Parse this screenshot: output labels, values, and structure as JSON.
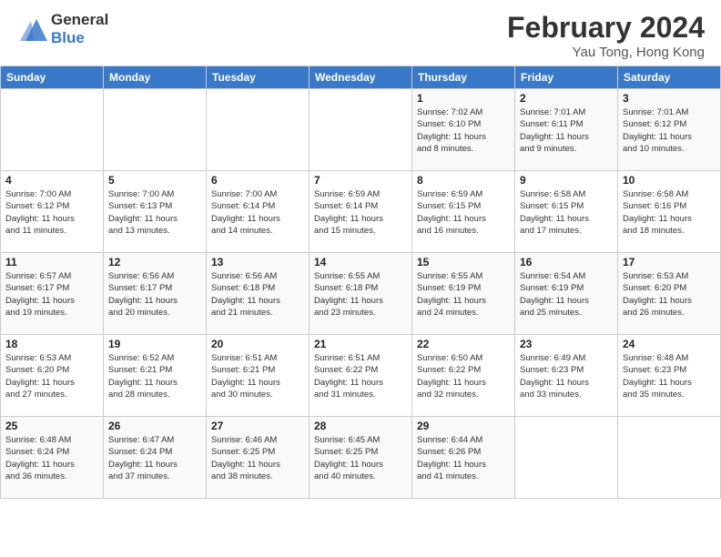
{
  "header": {
    "logo_line1": "General",
    "logo_line2": "Blue",
    "month": "February 2024",
    "location": "Yau Tong, Hong Kong"
  },
  "days_of_week": [
    "Sunday",
    "Monday",
    "Tuesday",
    "Wednesday",
    "Thursday",
    "Friday",
    "Saturday"
  ],
  "weeks": [
    [
      {
        "day": "",
        "info": ""
      },
      {
        "day": "",
        "info": ""
      },
      {
        "day": "",
        "info": ""
      },
      {
        "day": "",
        "info": ""
      },
      {
        "day": "1",
        "info": "Sunrise: 7:02 AM\nSunset: 6:10 PM\nDaylight: 11 hours\nand 8 minutes."
      },
      {
        "day": "2",
        "info": "Sunrise: 7:01 AM\nSunset: 6:11 PM\nDaylight: 11 hours\nand 9 minutes."
      },
      {
        "day": "3",
        "info": "Sunrise: 7:01 AM\nSunset: 6:12 PM\nDaylight: 11 hours\nand 10 minutes."
      }
    ],
    [
      {
        "day": "4",
        "info": "Sunrise: 7:00 AM\nSunset: 6:12 PM\nDaylight: 11 hours\nand 11 minutes."
      },
      {
        "day": "5",
        "info": "Sunrise: 7:00 AM\nSunset: 6:13 PM\nDaylight: 11 hours\nand 13 minutes."
      },
      {
        "day": "6",
        "info": "Sunrise: 7:00 AM\nSunset: 6:14 PM\nDaylight: 11 hours\nand 14 minutes."
      },
      {
        "day": "7",
        "info": "Sunrise: 6:59 AM\nSunset: 6:14 PM\nDaylight: 11 hours\nand 15 minutes."
      },
      {
        "day": "8",
        "info": "Sunrise: 6:59 AM\nSunset: 6:15 PM\nDaylight: 11 hours\nand 16 minutes."
      },
      {
        "day": "9",
        "info": "Sunrise: 6:58 AM\nSunset: 6:15 PM\nDaylight: 11 hours\nand 17 minutes."
      },
      {
        "day": "10",
        "info": "Sunrise: 6:58 AM\nSunset: 6:16 PM\nDaylight: 11 hours\nand 18 minutes."
      }
    ],
    [
      {
        "day": "11",
        "info": "Sunrise: 6:57 AM\nSunset: 6:17 PM\nDaylight: 11 hours\nand 19 minutes."
      },
      {
        "day": "12",
        "info": "Sunrise: 6:56 AM\nSunset: 6:17 PM\nDaylight: 11 hours\nand 20 minutes."
      },
      {
        "day": "13",
        "info": "Sunrise: 6:56 AM\nSunset: 6:18 PM\nDaylight: 11 hours\nand 21 minutes."
      },
      {
        "day": "14",
        "info": "Sunrise: 6:55 AM\nSunset: 6:18 PM\nDaylight: 11 hours\nand 23 minutes."
      },
      {
        "day": "15",
        "info": "Sunrise: 6:55 AM\nSunset: 6:19 PM\nDaylight: 11 hours\nand 24 minutes."
      },
      {
        "day": "16",
        "info": "Sunrise: 6:54 AM\nSunset: 6:19 PM\nDaylight: 11 hours\nand 25 minutes."
      },
      {
        "day": "17",
        "info": "Sunrise: 6:53 AM\nSunset: 6:20 PM\nDaylight: 11 hours\nand 26 minutes."
      }
    ],
    [
      {
        "day": "18",
        "info": "Sunrise: 6:53 AM\nSunset: 6:20 PM\nDaylight: 11 hours\nand 27 minutes."
      },
      {
        "day": "19",
        "info": "Sunrise: 6:52 AM\nSunset: 6:21 PM\nDaylight: 11 hours\nand 28 minutes."
      },
      {
        "day": "20",
        "info": "Sunrise: 6:51 AM\nSunset: 6:21 PM\nDaylight: 11 hours\nand 30 minutes."
      },
      {
        "day": "21",
        "info": "Sunrise: 6:51 AM\nSunset: 6:22 PM\nDaylight: 11 hours\nand 31 minutes."
      },
      {
        "day": "22",
        "info": "Sunrise: 6:50 AM\nSunset: 6:22 PM\nDaylight: 11 hours\nand 32 minutes."
      },
      {
        "day": "23",
        "info": "Sunrise: 6:49 AM\nSunset: 6:23 PM\nDaylight: 11 hours\nand 33 minutes."
      },
      {
        "day": "24",
        "info": "Sunrise: 6:48 AM\nSunset: 6:23 PM\nDaylight: 11 hours\nand 35 minutes."
      }
    ],
    [
      {
        "day": "25",
        "info": "Sunrise: 6:48 AM\nSunset: 6:24 PM\nDaylight: 11 hours\nand 36 minutes."
      },
      {
        "day": "26",
        "info": "Sunrise: 6:47 AM\nSunset: 6:24 PM\nDaylight: 11 hours\nand 37 minutes."
      },
      {
        "day": "27",
        "info": "Sunrise: 6:46 AM\nSunset: 6:25 PM\nDaylight: 11 hours\nand 38 minutes."
      },
      {
        "day": "28",
        "info": "Sunrise: 6:45 AM\nSunset: 6:25 PM\nDaylight: 11 hours\nand 40 minutes."
      },
      {
        "day": "29",
        "info": "Sunrise: 6:44 AM\nSunset: 6:26 PM\nDaylight: 11 hours\nand 41 minutes."
      },
      {
        "day": "",
        "info": ""
      },
      {
        "day": "",
        "info": ""
      }
    ]
  ]
}
